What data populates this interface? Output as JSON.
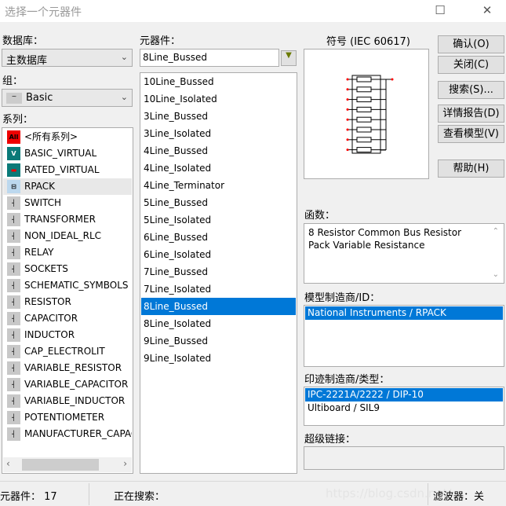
{
  "window": {
    "title": "选择一个元器件"
  },
  "database": {
    "label": "数据库：",
    "value": "主数据库"
  },
  "group": {
    "label": "组：",
    "value": "Basic"
  },
  "family": {
    "label": "系列：",
    "items": [
      {
        "label": "<所有系列>",
        "icon": "all-icon"
      },
      {
        "label": "BASIC_VIRTUAL",
        "icon": "basic-virtual-icon"
      },
      {
        "label": "RATED_VIRTUAL",
        "icon": "rated-virtual-icon"
      },
      {
        "label": "RPACK",
        "icon": "rpack-icon"
      },
      {
        "label": "SWITCH",
        "icon": "switch-icon"
      },
      {
        "label": "TRANSFORMER",
        "icon": "transformer-icon"
      },
      {
        "label": "NON_IDEAL_RLC",
        "icon": "non-ideal-rlc-icon"
      },
      {
        "label": "RELAY",
        "icon": "relay-icon"
      },
      {
        "label": "SOCKETS",
        "icon": "sockets-icon"
      },
      {
        "label": "SCHEMATIC_SYMBOLS",
        "icon": "schematic-symbols-icon"
      },
      {
        "label": "RESISTOR",
        "icon": "resistor-icon"
      },
      {
        "label": "CAPACITOR",
        "icon": "capacitor-icon"
      },
      {
        "label": "INDUCTOR",
        "icon": "inductor-icon"
      },
      {
        "label": "CAP_ELECTROLIT",
        "icon": "cap-electrolit-icon"
      },
      {
        "label": "VARIABLE_RESISTOR",
        "icon": "variable-resistor-icon"
      },
      {
        "label": "VARIABLE_CAPACITOR",
        "icon": "variable-capacitor-icon"
      },
      {
        "label": "VARIABLE_INDUCTOR",
        "icon": "variable-inductor-icon"
      },
      {
        "label": "POTENTIOMETER",
        "icon": "potentiometer-icon"
      },
      {
        "label": "MANUFACTURER_CAPACITOR",
        "icon": "manufacturer-capacitor-icon"
      }
    ],
    "selected": "RPACK"
  },
  "component": {
    "label": "元器件：",
    "value": "8Line_Bussed",
    "items": [
      "10Line_Bussed",
      "10Line_Isolated",
      "3Line_Bussed",
      "3Line_Isolated",
      "4Line_Bussed",
      "4Line_Isolated",
      "4Line_Terminator",
      "5Line_Bussed",
      "5Line_Isolated",
      "6Line_Bussed",
      "6Line_Isolated",
      "7Line_Bussed",
      "7Line_Isolated",
      "8Line_Bussed",
      "8Line_Isolated",
      "9Line_Bussed",
      "9Line_Isolated"
    ],
    "selected": "8Line_Bussed"
  },
  "symbol": {
    "label": "符号 (IEC 60617)"
  },
  "buttons": {
    "ok": "确认(O)",
    "close": "关闭(C)",
    "search": "搜索(S)...",
    "detail": "详情报告(D)",
    "model": "查看模型(V)",
    "help": "帮助(H)"
  },
  "function": {
    "label": "函数：",
    "text": "8 Resistor Common Bus Resistor Pack Variable Resistance"
  },
  "model_mfr": {
    "label": "模型制造商/ID：",
    "items": [
      "National Instruments / RPACK"
    ]
  },
  "footprint": {
    "label": "印迹制造商/类型：",
    "items": [
      "IPC-2221A/2222 / DIP-10",
      "Ultiboard / SIL9"
    ]
  },
  "hyperlink": {
    "label": "超级链接："
  },
  "status": {
    "count": "元器件：  17",
    "searching": "正在搜索：",
    "filter": "滤波器：关",
    "watermark": "https://blog.csdn.net/"
  },
  "colors": {
    "selection": "#0078d7",
    "pin": "#ff0000"
  }
}
